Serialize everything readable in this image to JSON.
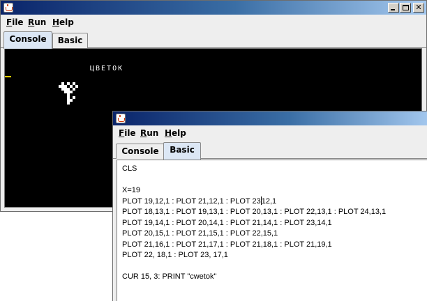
{
  "colors": {
    "titlebar_start": "#0a246a",
    "titlebar_end": "#a6caf0",
    "console_bg": "#000000",
    "console_text": "#ffffff",
    "console_cursor": "#ffd200",
    "active_tab": "#dce7f5"
  },
  "icons": {
    "app": "java-coffee-cup-icon",
    "minimize": "minimize-icon",
    "maximize": "maximize-icon",
    "close": "close-icon"
  },
  "back_window": {
    "menu": [
      {
        "label": "File",
        "mnemonic": "F",
        "rest": "ile"
      },
      {
        "label": "Run",
        "mnemonic": "R",
        "rest": "un"
      },
      {
        "label": "Help",
        "mnemonic": "H",
        "rest": "elp"
      }
    ],
    "tabs": [
      "Console",
      "Basic"
    ],
    "active_tab": "Console",
    "console": {
      "text": "ЦВЕТОК"
    }
  },
  "front_window": {
    "menu": [
      {
        "label": "File",
        "mnemonic": "F",
        "rest": "ile"
      },
      {
        "label": "Run",
        "mnemonic": "R",
        "rest": "un"
      },
      {
        "label": "Help",
        "mnemonic": "H",
        "rest": "elp"
      }
    ],
    "tabs": [
      "Console",
      "Basic"
    ],
    "active_tab": "Basic",
    "code": {
      "line1": "CLS",
      "line2": "",
      "line3": "X=19",
      "line4_before_caret": "PLOT 19,12,1 : PLOT 21,12,1 : PLOT 23",
      "line4_after_caret": "12,1",
      "line5": "PLOT 18,13,1 : PLOT 19,13,1 : PLOT 20,13,1 : PLOT 22,13,1 : PLOT 24,13,1",
      "line6": "PLOT 19,14,1 : PLOT 20,14,1 : PLOT 21,14,1 : PLOT 23,14,1",
      "line7": "PLOT 20,15,1 : PLOT 21,15,1 : PLOT 22,15,1",
      "line8": "PLOT 21,16,1 : PLOT 21,17,1 : PLOT 21,18,1 : PLOT 21,19,1",
      "line9": "PLOT 22, 18,1 : PLOT 23, 17,1",
      "line10": "",
      "line11": "CUR 15, 3: PRINT \"cwetok\""
    }
  }
}
